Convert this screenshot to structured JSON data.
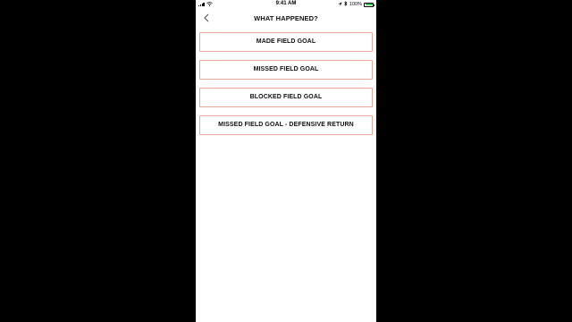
{
  "status_bar": {
    "time": "9:41 AM",
    "battery_percent": "100%",
    "battery_level": 1.0,
    "battery_color": "#2ecc40"
  },
  "nav": {
    "back_icon": "chevron-left-icon",
    "title": "WHAT HAPPENED?"
  },
  "options": [
    {
      "label": "MADE FIELD GOAL"
    },
    {
      "label": "MISSED FIELD GOAL"
    },
    {
      "label": "BLOCKED FIELD GOAL"
    },
    {
      "label": "MISSED FIELD GOAL - DEFENSIVE RETURN"
    }
  ],
  "colors": {
    "button_border": "#e3a79a",
    "background": "#ffffff",
    "letterbox": "#000000"
  }
}
